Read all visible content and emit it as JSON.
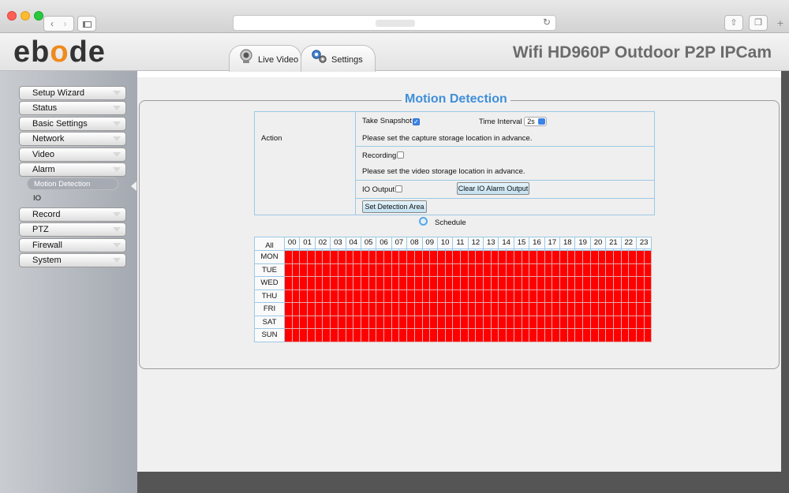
{
  "header": {
    "logo": [
      "eb",
      "o",
      "de"
    ],
    "tabs": [
      {
        "label": "Live Video",
        "icon": "camera-icon"
      },
      {
        "label": "Settings",
        "icon": "gears-icon"
      }
    ],
    "product_name": "Wifi HD960P Outdoor P2P IPCam"
  },
  "sidebar": {
    "items": [
      {
        "label": "Setup Wizard"
      },
      {
        "label": "Status"
      },
      {
        "label": "Basic Settings"
      },
      {
        "label": "Network"
      },
      {
        "label": "Video"
      },
      {
        "label": "Alarm"
      },
      {
        "label": "Record"
      },
      {
        "label": "PTZ"
      },
      {
        "label": "Firewall"
      },
      {
        "label": "System"
      }
    ],
    "sub_items": [
      {
        "label": "Motion Detection",
        "active": true
      },
      {
        "label": "IO",
        "active": false
      }
    ]
  },
  "panel": {
    "title": "Motion Detection",
    "action_label": "Action",
    "take_snapshot": {
      "label": "Take Snapshot",
      "checked": true
    },
    "time_interval": {
      "label": "Time Interval",
      "value": "2s"
    },
    "snapshot_note": "Please set the capture storage location in advance.",
    "recording": {
      "label": "Recording",
      "checked": false
    },
    "recording_note": "Please set the video storage location in advance.",
    "io_output": {
      "label": "IO Output",
      "checked": false
    },
    "clear_button": "Clear IO Alarm Output",
    "detection_button": "Set Detection Area",
    "schedule_label": "Schedule"
  },
  "schedule": {
    "all_label": "All",
    "hours": [
      "00",
      "01",
      "02",
      "03",
      "04",
      "05",
      "06",
      "07",
      "08",
      "09",
      "10",
      "11",
      "12",
      "13",
      "14",
      "15",
      "16",
      "17",
      "18",
      "19",
      "20",
      "21",
      "22",
      "23"
    ],
    "days": [
      "MON",
      "TUE",
      "WED",
      "THU",
      "FRI",
      "SAT",
      "SUN"
    ],
    "active_color": "#ff0000"
  },
  "colors": {
    "title_blue": "#3f8fd9",
    "logo_accent": "#f08a1d"
  }
}
